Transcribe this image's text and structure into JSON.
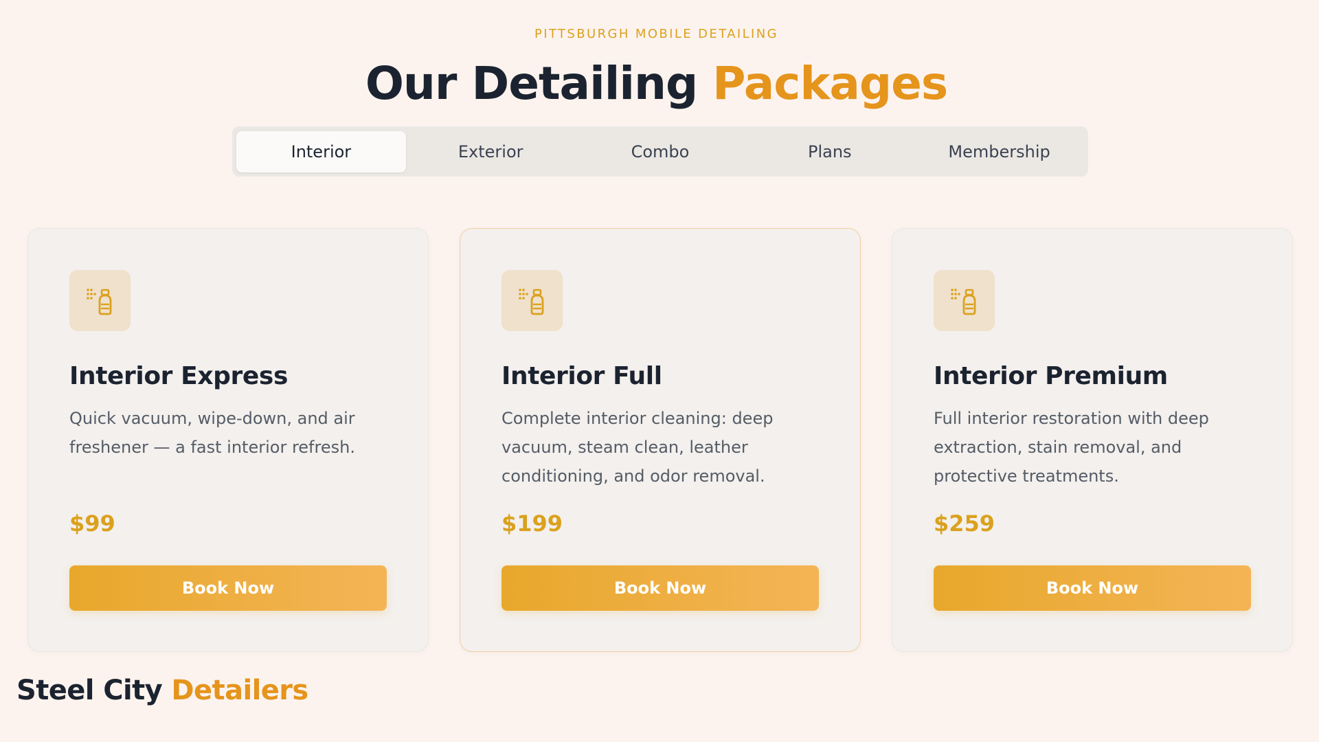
{
  "section": {
    "eyebrow": "PITTSBURGH MOBILE DETAILING",
    "title_main": "Our Detailing ",
    "title_accent": "Packages"
  },
  "tabs": [
    {
      "label": "Interior",
      "active": true
    },
    {
      "label": "Exterior",
      "active": false
    },
    {
      "label": "Combo",
      "active": false
    },
    {
      "label": "Plans",
      "active": false
    },
    {
      "label": "Membership",
      "active": false
    }
  ],
  "cards": [
    {
      "icon": "spray-bottle-icon",
      "title": "Interior Express",
      "description": "Quick vacuum, wipe-down, and air freshener — a fast interior refresh.",
      "price": "$99",
      "button": "Book Now",
      "featured": false
    },
    {
      "icon": "spray-bottle-icon",
      "title": "Interior Full",
      "description": "Complete interior cleaning: deep vacuum, steam clean, leather conditioning, and odor removal.",
      "price": "$199",
      "button": "Book Now",
      "featured": true
    },
    {
      "icon": "spray-bottle-icon",
      "title": "Interior Premium",
      "description": "Full interior restoration with deep extraction, stain removal, and protective treatments.",
      "price": "$259",
      "button": "Book Now",
      "featured": false
    }
  ],
  "brand": {
    "name_main": "Steel City ",
    "name_accent": "Detailers"
  },
  "colors": {
    "background": "#fcf3ee",
    "accent": "#e5941c",
    "price": "#dba11e",
    "button_start": "#e8a82c",
    "button_end": "#f4b456",
    "heading": "#1c2330"
  }
}
